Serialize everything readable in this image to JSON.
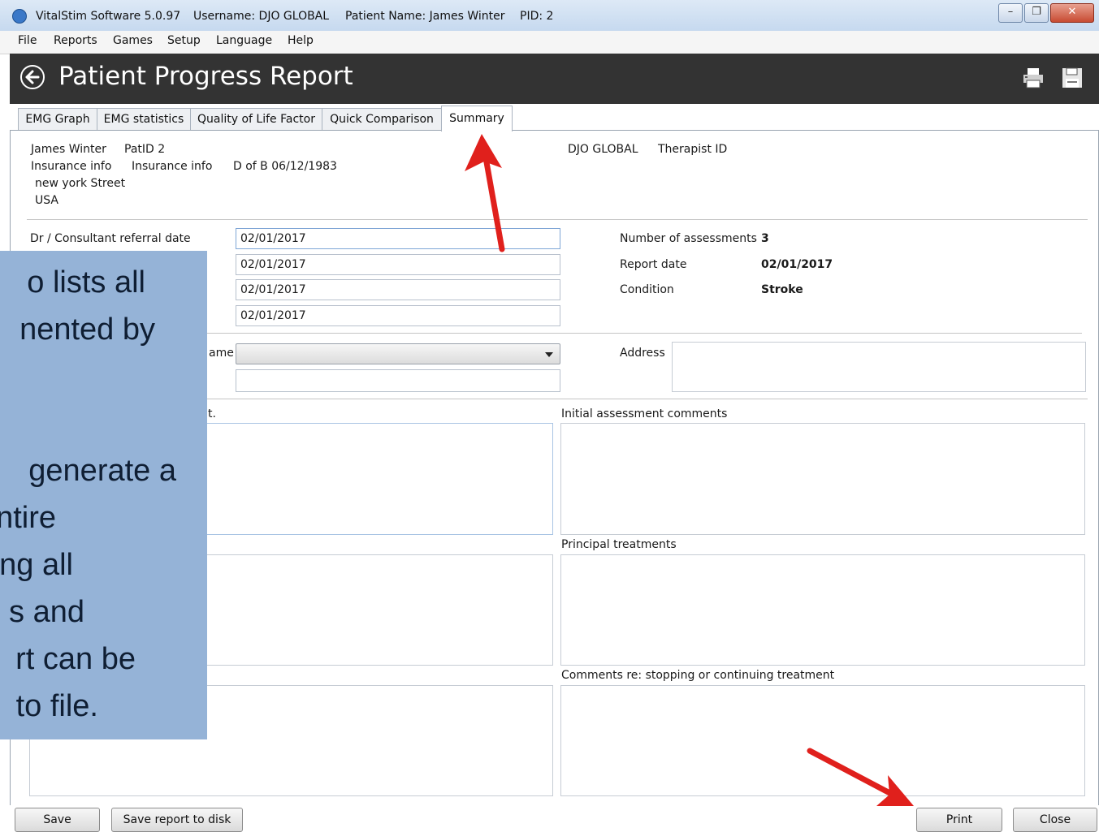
{
  "window": {
    "title_parts": [
      "VitalStim Software 5.0.97",
      "Username: DJO GLOBAL",
      "Patient Name: James Winter",
      "PID: 2"
    ],
    "minimize_icon": "minimize-icon",
    "restore_icon": "restore-icon",
    "close_icon": "close-icon"
  },
  "menu": [
    "File",
    "Reports",
    "Games",
    "Setup",
    "Language",
    "Help"
  ],
  "header": {
    "title": "Patient Progress Report",
    "back_icon": "back-arrow-icon",
    "print_icon": "printer-icon",
    "save_icon": "floppy-disk-icon"
  },
  "tabs": [
    "EMG Graph",
    "EMG statistics",
    "Quality of Life Factor",
    "Quick Comparison",
    "Summary"
  ],
  "active_tab": "Summary",
  "patient": {
    "name": "James Winter",
    "pat_id": "PatID 2",
    "insurance_label": "Insurance info",
    "insurance_value": "Insurance info",
    "dob": "D of B 06/12/1983",
    "street": "new york Street",
    "country": "USA",
    "organization": "DJO GLOBAL",
    "therapist_label": "Therapist ID"
  },
  "form": {
    "referral_label": "Dr / Consultant referral date",
    "dates": [
      "02/01/2017",
      "02/01/2017",
      "02/01/2017",
      "02/01/2017"
    ],
    "name_label_fragment": "ame",
    "name_selected": "",
    "extra_field": "",
    "address_label": "Address",
    "address_value": "",
    "left_comments_label_fragment": "t.",
    "initial_comments_label": "Initial assessment comments",
    "principal_treatments_label": "Principal treatments",
    "stopping_label": "Comments re: stopping or continuing treatment"
  },
  "summary": {
    "assessments_label": "Number of assessments",
    "assessments_value": "3",
    "report_date_label": "Report date",
    "report_date_value": "02/01/2017",
    "condition_label": "Condition",
    "condition_value": "Stroke"
  },
  "buttons": {
    "save": "Save",
    "save_disk": "Save report to disk",
    "print": "Print",
    "close": "Close"
  },
  "overlay_lines": [
    "o lists all",
    "nented by",
    "",
    "",
    "generate a",
    "ntire",
    "ng all",
    "s and",
    "rt can be",
    "to file."
  ],
  "colors": {
    "header_bg": "#333333",
    "overlay_bg": "#95b3d7",
    "annotation_arrow": "#e0201c"
  }
}
